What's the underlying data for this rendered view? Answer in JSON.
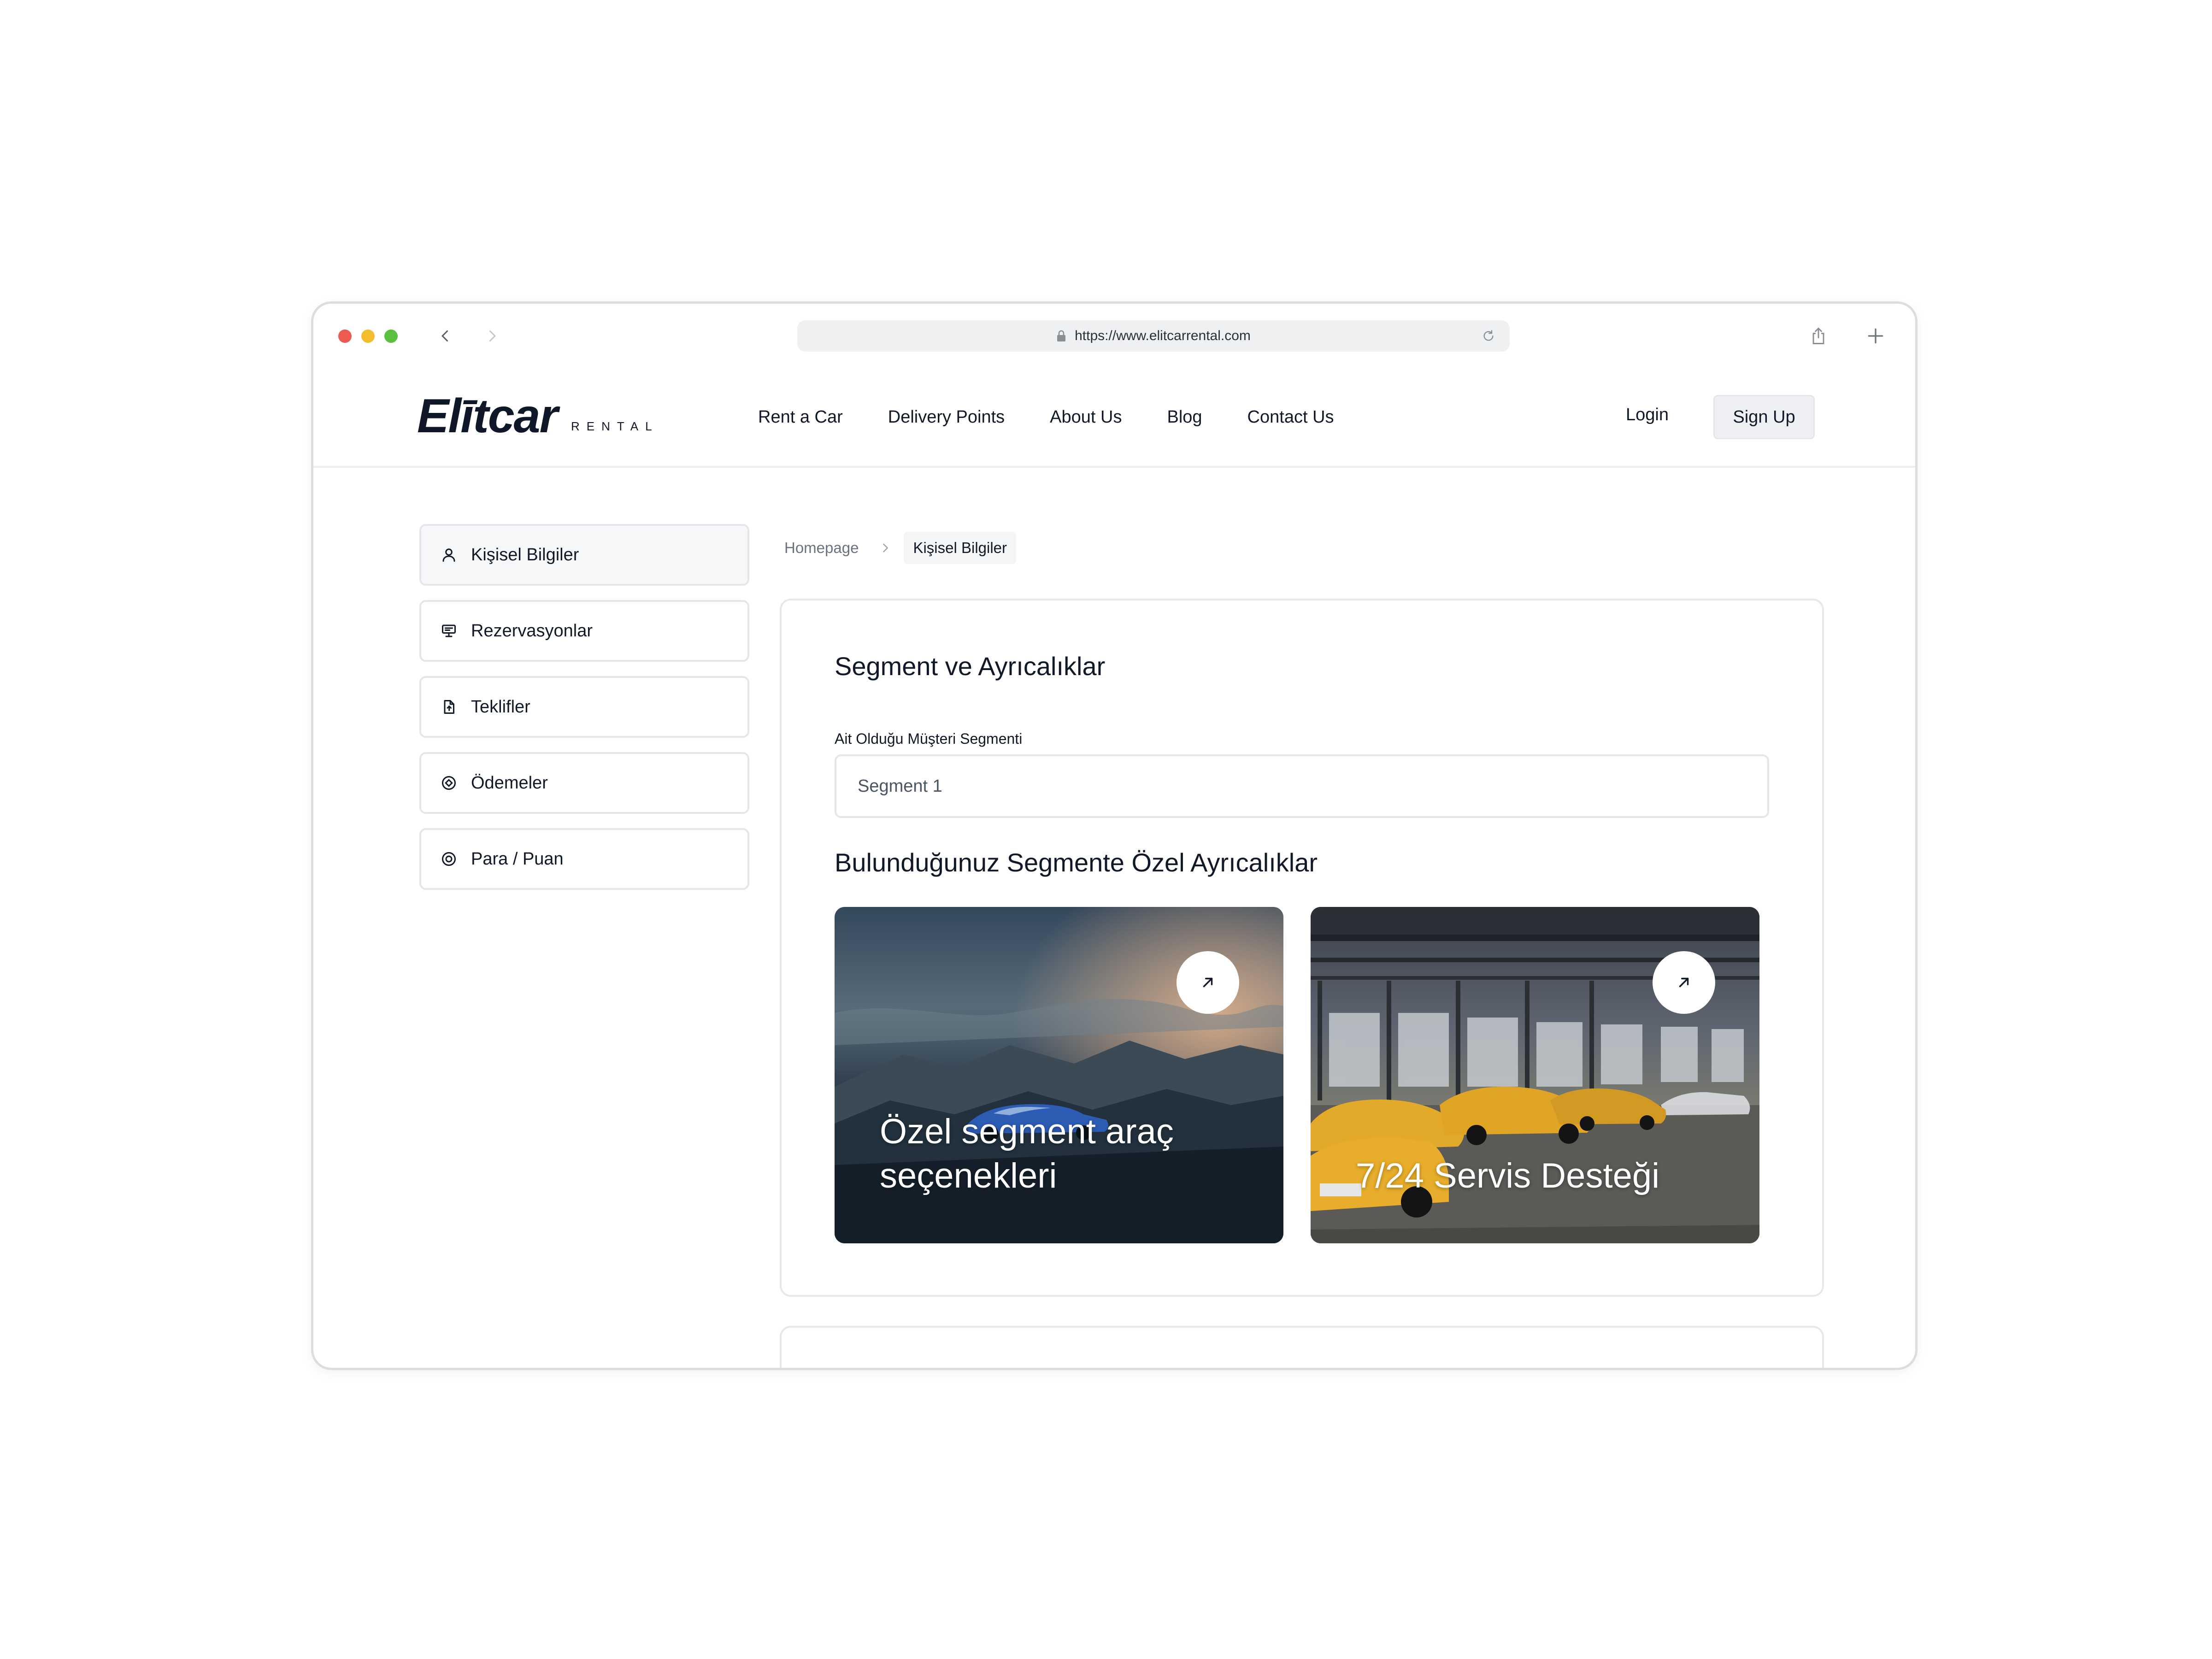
{
  "browser": {
    "url": "https://www.elitcarrental.com"
  },
  "header": {
    "logo_main": "Elītcar",
    "logo_sub": "RENTAL",
    "nav": [
      {
        "label": "Rent a Car"
      },
      {
        "label": "Delivery Points"
      },
      {
        "label": "About Us"
      },
      {
        "label": "Blog"
      },
      {
        "label": "Contact Us"
      }
    ],
    "login_label": "Login",
    "signup_label": "Sign Up"
  },
  "sidebar": {
    "items": [
      {
        "label": "Kişisel Bilgiler",
        "icon": "user-icon"
      },
      {
        "label": "Rezervasyonlar",
        "icon": "monitor-icon"
      },
      {
        "label": "Teklifler",
        "icon": "document-icon"
      },
      {
        "label": "Ödemeler",
        "icon": "coin-icon"
      },
      {
        "label": "Para / Puan",
        "icon": "coin-icon"
      }
    ]
  },
  "breadcrumb": {
    "home": "Homepage",
    "current": "Kişisel Bilgiler"
  },
  "main": {
    "title": "Segment ve Ayrıcalıklar",
    "segment_label": "Ait Olduğu Müşteri Segmenti",
    "segment_value": "Segment 1",
    "privileges_title": "Bulunduğunuz Segmente Özel Ayrıcalıklar",
    "cards": [
      {
        "line1": "Özel segment araç",
        "line2": "seçenekleri"
      },
      {
        "line1": "7/24 Servis Desteği"
      }
    ]
  }
}
